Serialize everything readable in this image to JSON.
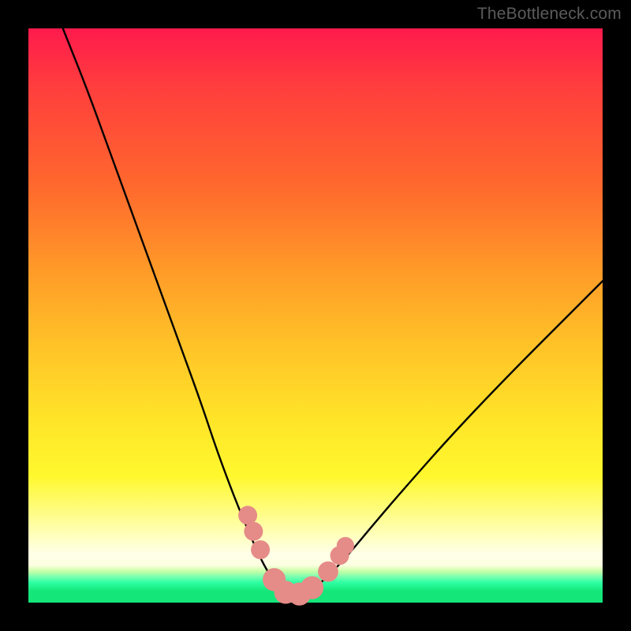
{
  "watermark": "TheBottleneck.com",
  "chart_data": {
    "type": "line",
    "title": "",
    "xlabel": "",
    "ylabel": "",
    "xlim": [
      0,
      100
    ],
    "ylim": [
      0,
      100
    ],
    "annotations": [],
    "series": [
      {
        "name": "curve",
        "color": "#000000",
        "x": [
          6,
          10,
          14,
          18,
          22,
          26,
          30,
          33,
          36,
          38.5,
          40.5,
          42.5,
          44,
          46,
          48,
          51,
          55,
          60,
          66,
          74,
          84,
          96,
          100
        ],
        "y": [
          100,
          90,
          79,
          68,
          57,
          46,
          35,
          26,
          18,
          12,
          7.5,
          4,
          2.2,
          1.3,
          1.6,
          3.4,
          7.5,
          13.5,
          20.5,
          29.5,
          40,
          52,
          56
        ]
      }
    ],
    "markers": [
      {
        "name": "dot",
        "x": 38.2,
        "y": 15.2,
        "r": 1.6,
        "color": "#e58b88"
      },
      {
        "name": "dot",
        "x": 39.2,
        "y": 12.4,
        "r": 1.6,
        "color": "#e58b88"
      },
      {
        "name": "dot",
        "x": 40.4,
        "y": 9.2,
        "r": 1.6,
        "color": "#e58b88"
      },
      {
        "name": "dot",
        "x": 42.8,
        "y": 4.0,
        "r": 2.2,
        "color": "#e58b88"
      },
      {
        "name": "dot",
        "x": 44.8,
        "y": 1.8,
        "r": 2.2,
        "color": "#e58b88"
      },
      {
        "name": "dot",
        "x": 47.2,
        "y": 1.5,
        "r": 2.2,
        "color": "#e58b88"
      },
      {
        "name": "dot",
        "x": 49.4,
        "y": 2.6,
        "r": 2.2,
        "color": "#e58b88"
      },
      {
        "name": "dot",
        "x": 52.2,
        "y": 5.4,
        "r": 1.8,
        "color": "#e58b88"
      },
      {
        "name": "dot",
        "x": 54.2,
        "y": 8.2,
        "r": 1.6,
        "color": "#e58b88"
      },
      {
        "name": "dot",
        "x": 55.2,
        "y": 9.9,
        "r": 1.4,
        "color": "#e58b88"
      }
    ],
    "gradient_stops": [
      {
        "pos": 0,
        "color": "#ff1a4d"
      },
      {
        "pos": 0.42,
        "color": "#ff9a28"
      },
      {
        "pos": 0.78,
        "color": "#fff82e"
      },
      {
        "pos": 0.92,
        "color": "#ffffe8"
      },
      {
        "pos": 1.0,
        "color": "#14e67a"
      }
    ]
  }
}
